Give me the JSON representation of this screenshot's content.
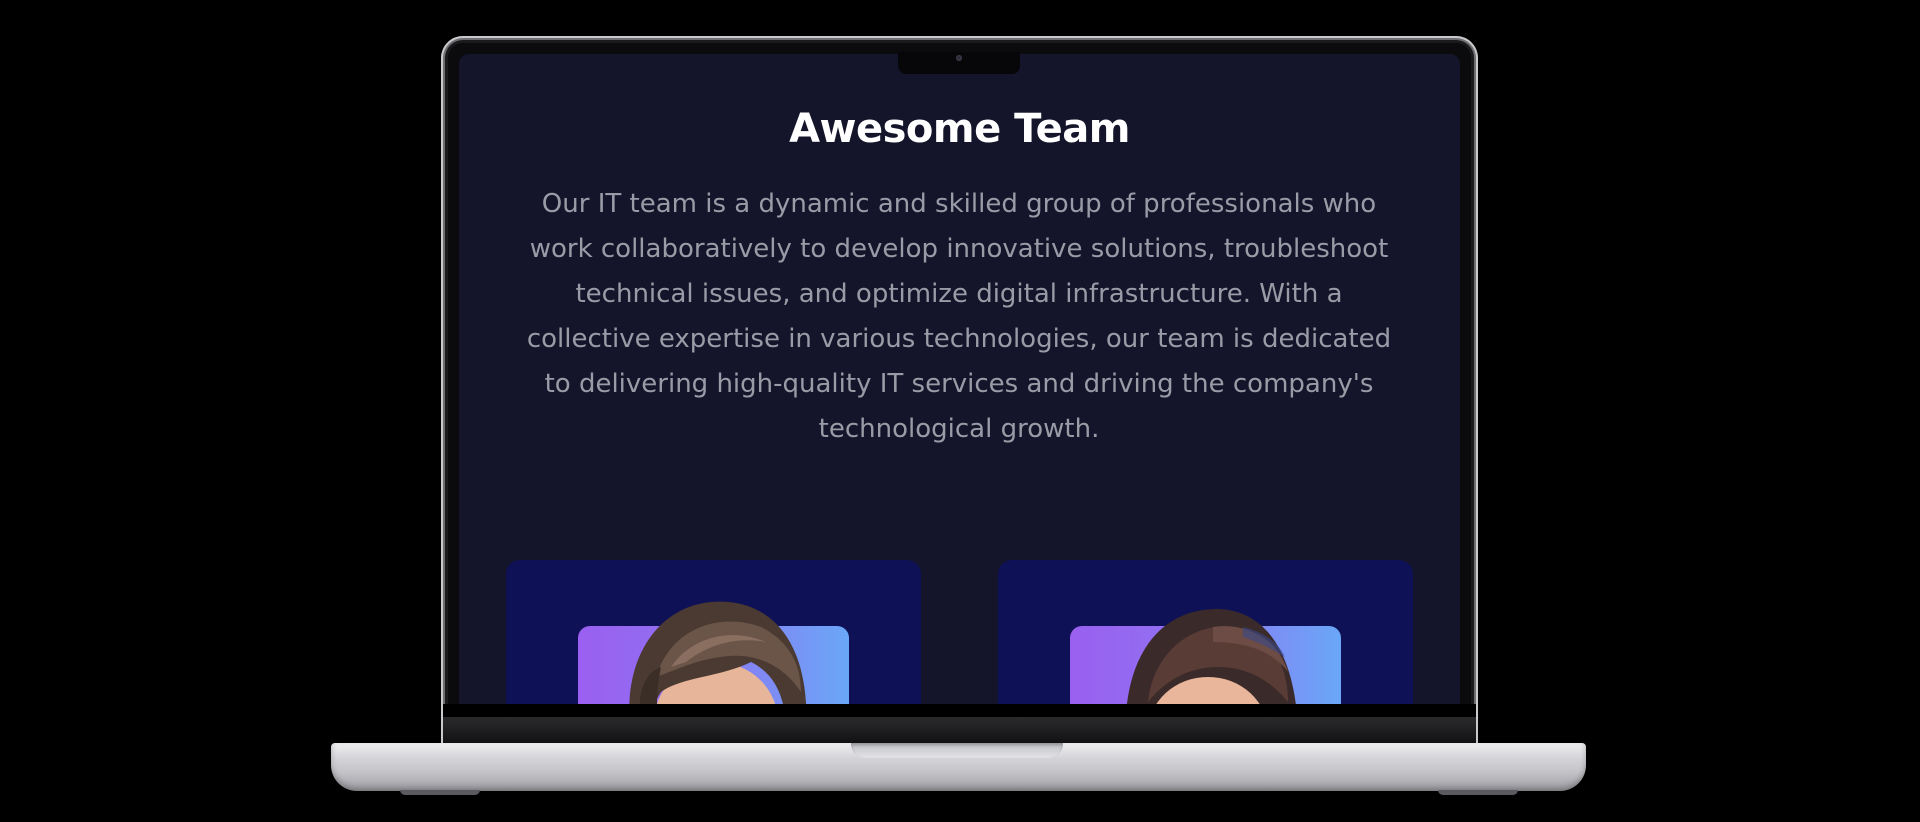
{
  "section": {
    "title": "Awesome Team",
    "description": "Our IT team is a dynamic and skilled group of professionals who work collaboratively to develop innovative solutions, troubleshoot technical issues, and optimize digital infrastructure. With a collective expertise in various technologies, our team is dedicated to delivering high-quality IT services and driving the company's technological growth."
  },
  "team_cards": [
    {
      "avatar_icon": "male-avatar-icon"
    },
    {
      "avatar_icon": "female-avatar-icon"
    }
  ],
  "colors": {
    "page_background": "#000000",
    "screen_background": "#14152a",
    "card_background": "#0f1156",
    "title_color": "#ffffff",
    "text_color": "#9b9ba7",
    "avatar_gradient_start": "#9a5ff0",
    "avatar_gradient_end": "#6aa7f7"
  }
}
